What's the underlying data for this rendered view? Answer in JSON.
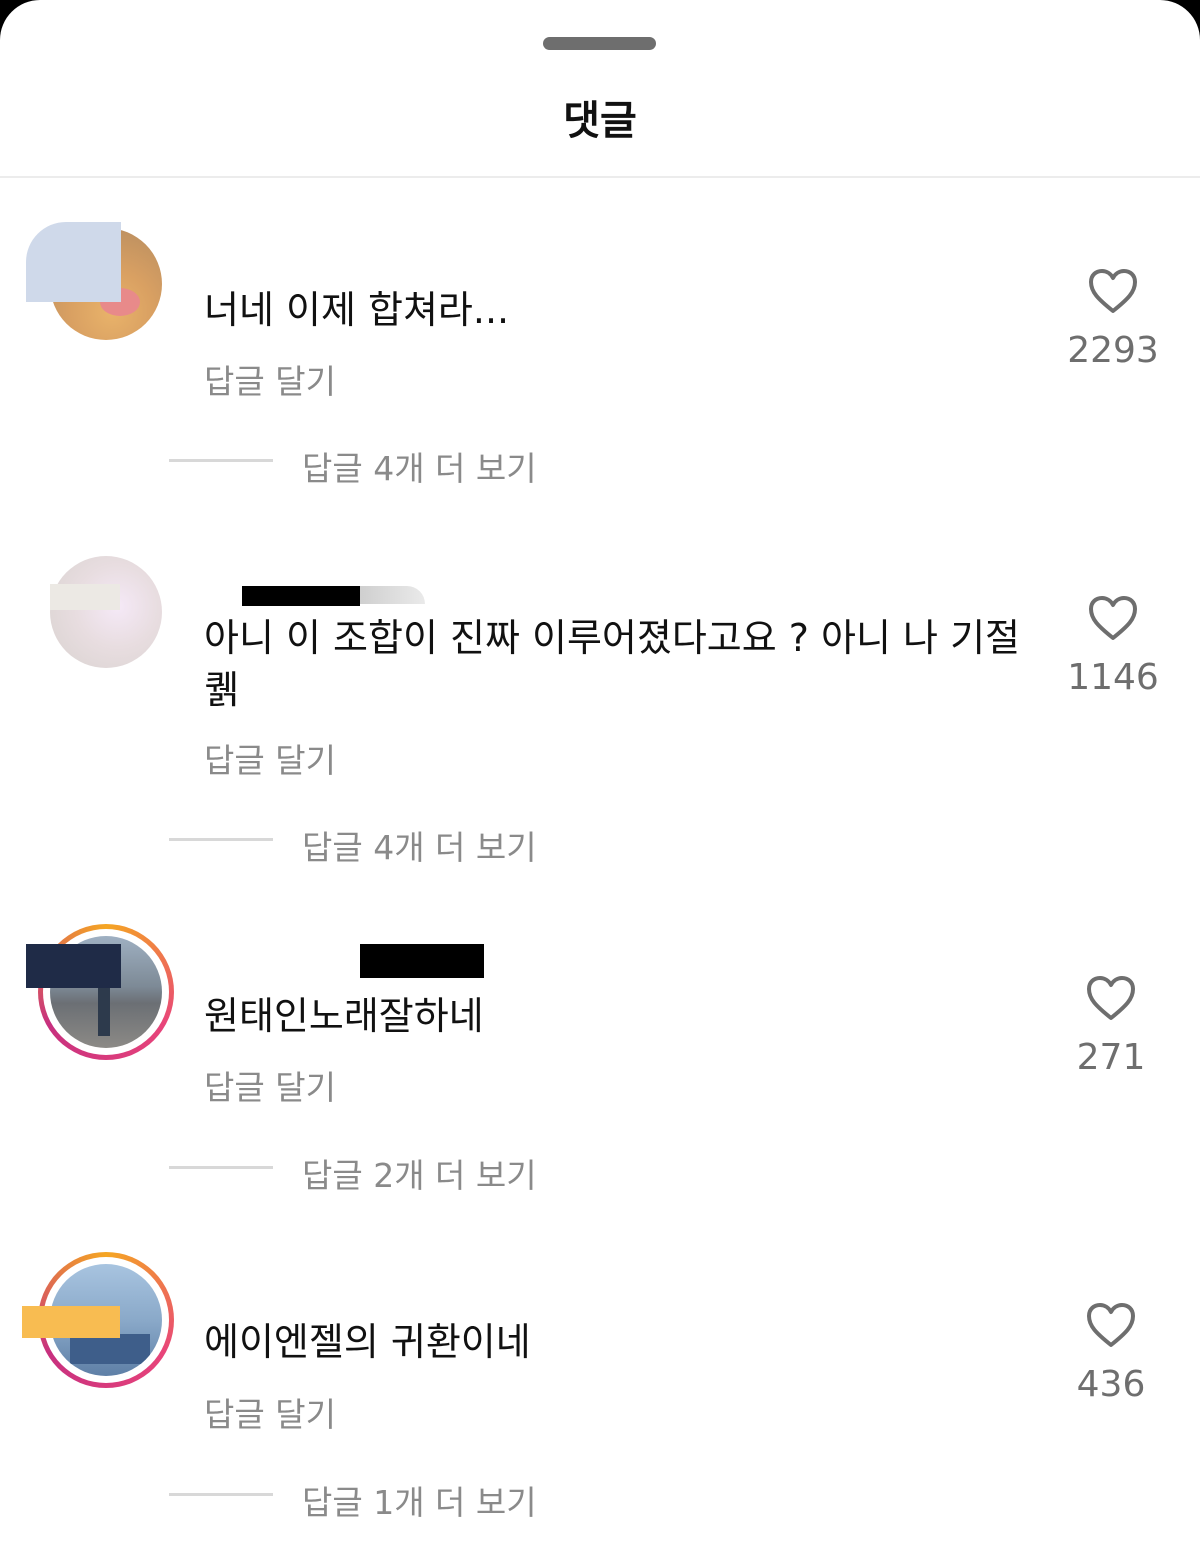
{
  "sheet": {
    "title": "댓글"
  },
  "comments": [
    {
      "text": "너네 이제 합쳐라...",
      "reply_label": "답글 달기",
      "likes": "2293",
      "more_replies": "답글 4개 더 보기"
    },
    {
      "text": "아니 이 조합이 진짜 이루어졌다고요 ? 아니 나 기절\n퀡",
      "reply_label": "답글 달기",
      "likes": "1146",
      "more_replies": "답글 4개 더 보기"
    },
    {
      "text": "원태인노래잘하네",
      "reply_label": "답글 달기",
      "likes": "271",
      "more_replies": "답글 2개 더 보기"
    },
    {
      "text": "에이엔젤의 귀환이네",
      "reply_label": "답글 달기",
      "likes": "436",
      "more_replies": "답글 1개 더 보기"
    }
  ],
  "colors": {
    "text": "#111111",
    "muted": "#8a8a8a",
    "story_ring": [
      "#f5a623",
      "#e8447a"
    ]
  },
  "icons": {
    "like": "heart-outline-icon"
  }
}
